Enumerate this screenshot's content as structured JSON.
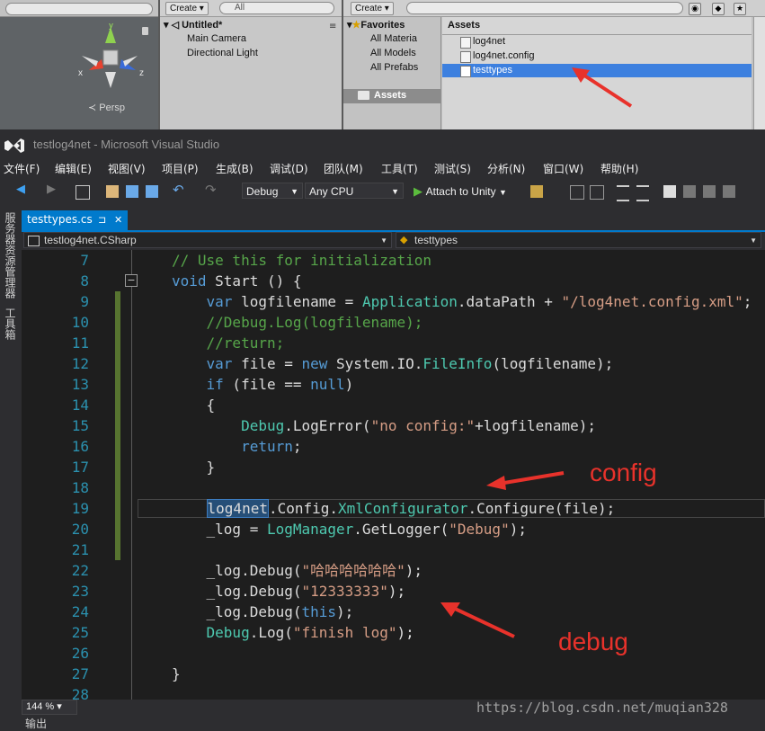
{
  "unity": {
    "scene": {
      "persp_label": "Persp",
      "axis_y": "y",
      "axis_x": "x",
      "axis_z": "z"
    },
    "hierarchy": {
      "create_label": "Create",
      "search_placeholder": "All",
      "scene_name": "Untitled*",
      "items": [
        "Main Camera",
        "Directional Light"
      ]
    },
    "project": {
      "create_label": "Create",
      "favorites_label": "Favorites",
      "favorites": [
        "All Materia",
        "All Models",
        "All Prefabs"
      ],
      "assets_folder": "Assets",
      "assets_header": "Assets",
      "assets": [
        "log4net",
        "log4net.config",
        "testtypes"
      ],
      "selected_index": 2
    }
  },
  "vs": {
    "window_title": "testlog4net - Microsoft Visual Studio",
    "menu": [
      "文件(F)",
      "编辑(E)",
      "视图(V)",
      "项目(P)",
      "生成(B)",
      "调试(D)",
      "团队(M)",
      "工具(T)",
      "测试(S)",
      "分析(N)",
      "窗口(W)",
      "帮助(H)"
    ],
    "toolbar": {
      "config": "Debug",
      "platform": "Any CPU",
      "attach_label": "Attach to Unity"
    },
    "side_panels": [
      "服务器资源管理器",
      "工具箱"
    ],
    "tab": {
      "label": "testtypes.cs",
      "pin": "⊐",
      "close": "✕"
    },
    "nav": {
      "project": "testlog4net.CSharp",
      "type": "testtypes"
    },
    "code_lines": [
      {
        "n": "7",
        "html": "<span class=\"t-c\">// Use this for initialization</span>"
      },
      {
        "n": "8",
        "html": "<span class=\"t-k\">void</span> Start () {"
      },
      {
        "n": "9",
        "html": "    <span class=\"t-k\">var</span> logfilename = <span class=\"t-t\">Application</span>.dataPath + <span class=\"t-s\">\"/log4net.config.xml\"</span>;"
      },
      {
        "n": "10",
        "html": "    <span class=\"t-c\">//Debug.Log(logfilename);</span>"
      },
      {
        "n": "11",
        "html": "    <span class=\"t-c\">//return;</span>"
      },
      {
        "n": "12",
        "html": "    <span class=\"t-k\">var</span> file = <span class=\"t-k\">new</span> System.IO.<span class=\"t-t\">FileInfo</span>(logfilename);"
      },
      {
        "n": "13",
        "html": "    <span class=\"t-k\">if</span> (file == <span class=\"t-k\">null</span>)"
      },
      {
        "n": "14",
        "html": "    {"
      },
      {
        "n": "15",
        "html": "        <span class=\"t-t\">Debug</span>.LogError(<span class=\"t-s\">\"no config:\"</span>+logfilename);"
      },
      {
        "n": "16",
        "html": "        <span class=\"t-k\">return</span>;"
      },
      {
        "n": "17",
        "html": "    }"
      },
      {
        "n": "18",
        "html": ""
      },
      {
        "n": "19",
        "html": "    <span style=\"border:1px solid #3d7cbf;background:#264f78;\">log4net</span>.Config.<span class=\"t-t\">XmlConfigurator</span>.Configure(file);"
      },
      {
        "n": "20",
        "html": "    _log = <span class=\"t-t\">LogManager</span>.GetLogger(<span class=\"t-s\">\"Debug\"</span>);"
      },
      {
        "n": "21",
        "html": ""
      },
      {
        "n": "22",
        "html": "    _log.Debug(<span class=\"t-s\">\"哈哈哈哈哈哈\"</span>);"
      },
      {
        "n": "23",
        "html": "    _log.Debug(<span class=\"t-s\">\"12333333\"</span>);"
      },
      {
        "n": "24",
        "html": "    _log.Debug(<span class=\"t-k\">this</span>);"
      },
      {
        "n": "25",
        "html": "    <span class=\"t-t\">Debug</span>.Log(<span class=\"t-s\">\"finish log\"</span>);"
      },
      {
        "n": "26",
        "html": ""
      },
      {
        "n": "27",
        "html": "}"
      },
      {
        "n": "28",
        "html": ""
      }
    ],
    "zoom": "144 %",
    "output_label": "输出"
  },
  "annotations": {
    "config": "config",
    "debug": "debug"
  },
  "watermark": "https://blog.csdn.net/muqian328",
  "colors": {
    "accent": "#007acc",
    "selection": "#3d80df",
    "annotation": "#e8322b"
  }
}
